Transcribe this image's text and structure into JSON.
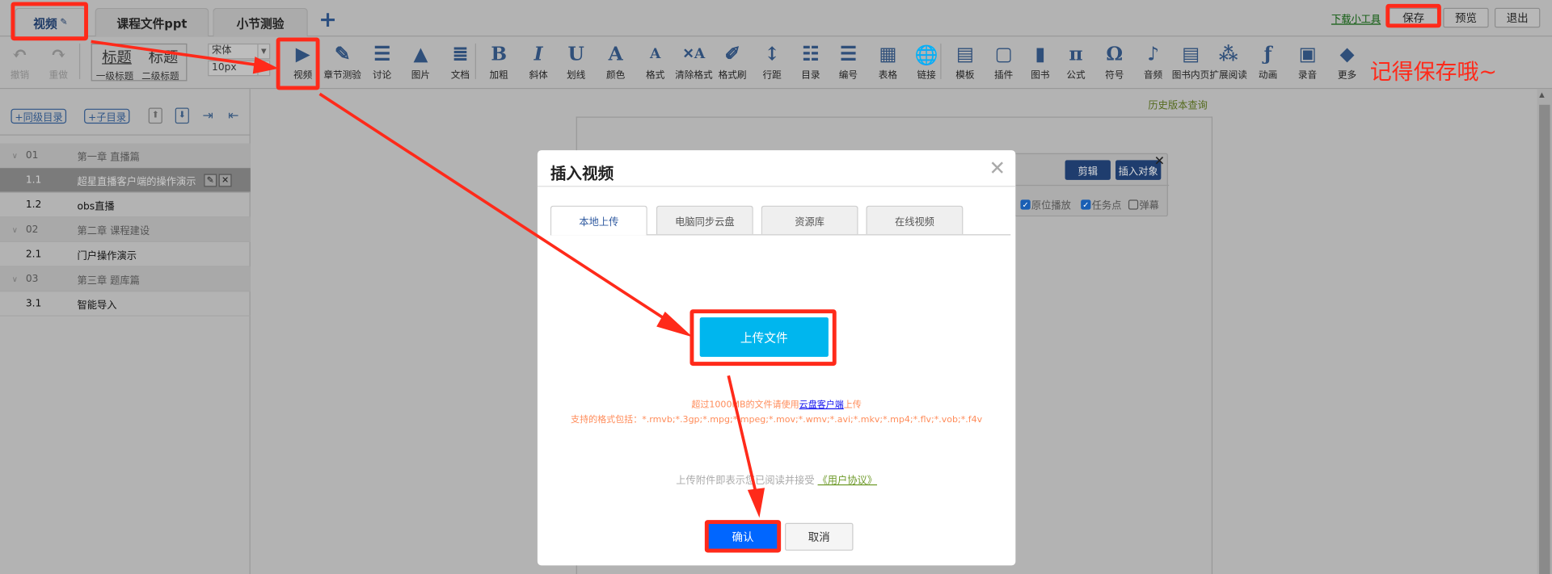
{
  "tabs": [
    {
      "label": "视频",
      "active": true
    },
    {
      "label": "课程文件ppt"
    },
    {
      "label": "小节测验"
    }
  ],
  "add_tab": "+",
  "top_actions": {
    "download_tool": "下载小工具",
    "save": "保存",
    "preview": "预览",
    "exit": "退出"
  },
  "toolbar": {
    "undo": "撤销",
    "redo": "重做",
    "heading1_big": "标题",
    "heading2_big": "标题",
    "heading1": "一级标题",
    "heading2": "二级标题",
    "font_family": "宋体",
    "font_size": "10px",
    "items": [
      {
        "label": "视频",
        "icon": "video-icon",
        "glyph": "▶"
      },
      {
        "label": "章节测验",
        "icon": "quiz-icon",
        "glyph": "✎"
      },
      {
        "label": "讨论",
        "icon": "discussion-icon",
        "glyph": "☰"
      },
      {
        "label": "图片",
        "icon": "image-icon",
        "glyph": "▲"
      },
      {
        "label": "文档",
        "icon": "document-icon",
        "glyph": "≣"
      },
      {
        "label": "加粗",
        "icon": "bold-icon",
        "glyph": "B"
      },
      {
        "label": "斜体",
        "icon": "italic-icon",
        "glyph": "I"
      },
      {
        "label": "划线",
        "icon": "underline-icon",
        "glyph": "U"
      },
      {
        "label": "颜色",
        "icon": "font-color-icon",
        "glyph": "A"
      },
      {
        "label": "格式",
        "icon": "format-icon",
        "glyph": "A"
      },
      {
        "label": "清除格式",
        "icon": "clear-format-icon",
        "glyph": "✕A"
      },
      {
        "label": "格式刷",
        "icon": "format-painter-icon",
        "glyph": "✐"
      },
      {
        "label": "行距",
        "icon": "line-spacing-icon",
        "glyph": "↕"
      },
      {
        "label": "目录",
        "icon": "list-icon",
        "glyph": "☷"
      },
      {
        "label": "编号",
        "icon": "numbered-list-icon",
        "glyph": "☰"
      },
      {
        "label": "表格",
        "icon": "table-icon",
        "glyph": "▦"
      },
      {
        "label": "链接",
        "icon": "link-icon",
        "glyph": "🌐"
      },
      {
        "label": "模板",
        "icon": "template-icon",
        "glyph": "▤"
      },
      {
        "label": "插件",
        "icon": "plugin-icon",
        "glyph": "▢"
      },
      {
        "label": "图书",
        "icon": "book-icon",
        "glyph": "▮"
      },
      {
        "label": "公式",
        "icon": "formula-icon",
        "glyph": "π"
      },
      {
        "label": "符号",
        "icon": "symbol-icon",
        "glyph": "Ω"
      },
      {
        "label": "音频",
        "icon": "audio-icon",
        "glyph": "♪"
      },
      {
        "label": "图书内页",
        "icon": "book-page-icon",
        "glyph": "▤"
      },
      {
        "label": "扩展阅读",
        "icon": "extended-reading-icon",
        "glyph": "⁂"
      },
      {
        "label": "动画",
        "icon": "animation-icon",
        "glyph": "ƒ"
      },
      {
        "label": "录音",
        "icon": "recording-icon",
        "glyph": "▣"
      },
      {
        "label": "更多",
        "icon": "more-icon",
        "glyph": "◆"
      }
    ]
  },
  "annotation": "记得保存哦~",
  "sidebar": {
    "add_sibling": "+同级目录",
    "add_child": "+子目录",
    "rows": [
      {
        "num": "01",
        "title": "第一章 直播篇",
        "type": "chapter"
      },
      {
        "num": "1.1",
        "title": "超星直播客户端的操作演示",
        "type": "current"
      },
      {
        "num": "1.2",
        "title": "obs直播",
        "type": "section"
      },
      {
        "num": "02",
        "title": "第二章 课程建设",
        "type": "chapter"
      },
      {
        "num": "2.1",
        "title": "门户操作演示",
        "type": "section"
      },
      {
        "num": "03",
        "title": "第三章 题库篇",
        "type": "chapter"
      },
      {
        "num": "3.1",
        "title": "智能导入",
        "type": "section"
      }
    ]
  },
  "editor": {
    "history": "历史版本查询",
    "video_widget": {
      "edit": "剪辑",
      "insert_object": "插入对象",
      "in_place_play": "原位播放",
      "task_point": "任务点",
      "danmaku": "弹幕",
      "close": "✕"
    }
  },
  "modal": {
    "title": "插入视频",
    "close": "✕",
    "tabs": [
      "本地上传",
      "电脑同步云盘",
      "资源库",
      "在线视频"
    ],
    "upload": "上传文件",
    "tip1_pre": "超过1000MB的文件请使用",
    "tip1_link": "云盘客户端",
    "tip1_post": "上传",
    "tip2": "支持的格式包括：*.rmvb;*.3gp;*.mpg;*.mpeg;*.mov;*.wmv;*.avi;*.mkv;*.mp4;*.flv;*.vob;*.f4v",
    "agree_pre": "上传附件即表示您已阅读并接受 ",
    "agree_link": "《用户协议》",
    "confirm": "确认",
    "cancel": "取消"
  },
  "colors": {
    "annotation_red": "#ff2a1a",
    "upload_blue": "#00b6ee",
    "confirm_blue": "#0066ff"
  }
}
